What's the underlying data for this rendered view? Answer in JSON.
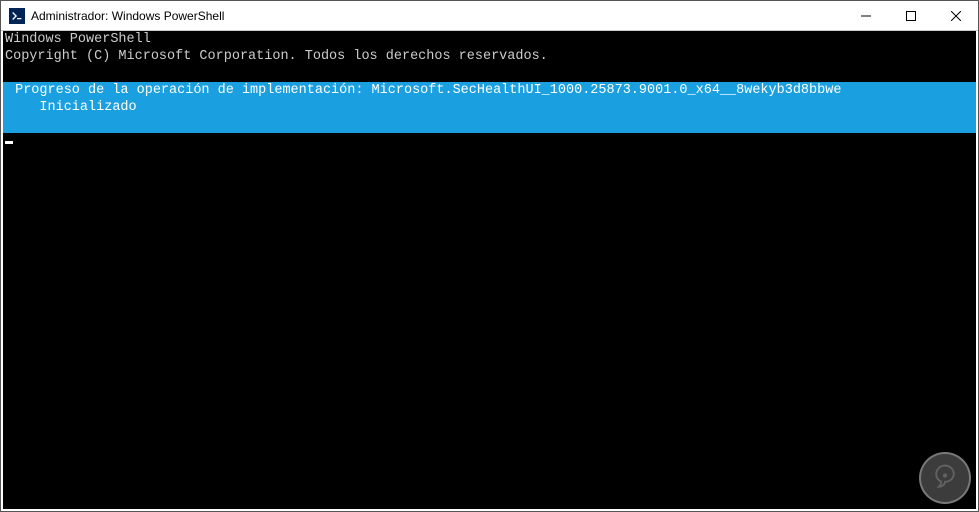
{
  "window": {
    "title": "Administrador: Windows PowerShell"
  },
  "terminal": {
    "line1": "Windows PowerShell",
    "line2": "Copyright (C) Microsoft Corporation. Todos los derechos reservados.",
    "progress": {
      "line1": " Progreso de la operación de implementación: Microsoft.SecHealthUI_1000.25873.9001.0_x64__8wekyb3d8bbwe",
      "line2": "    Inicializado",
      "line3": " "
    }
  }
}
